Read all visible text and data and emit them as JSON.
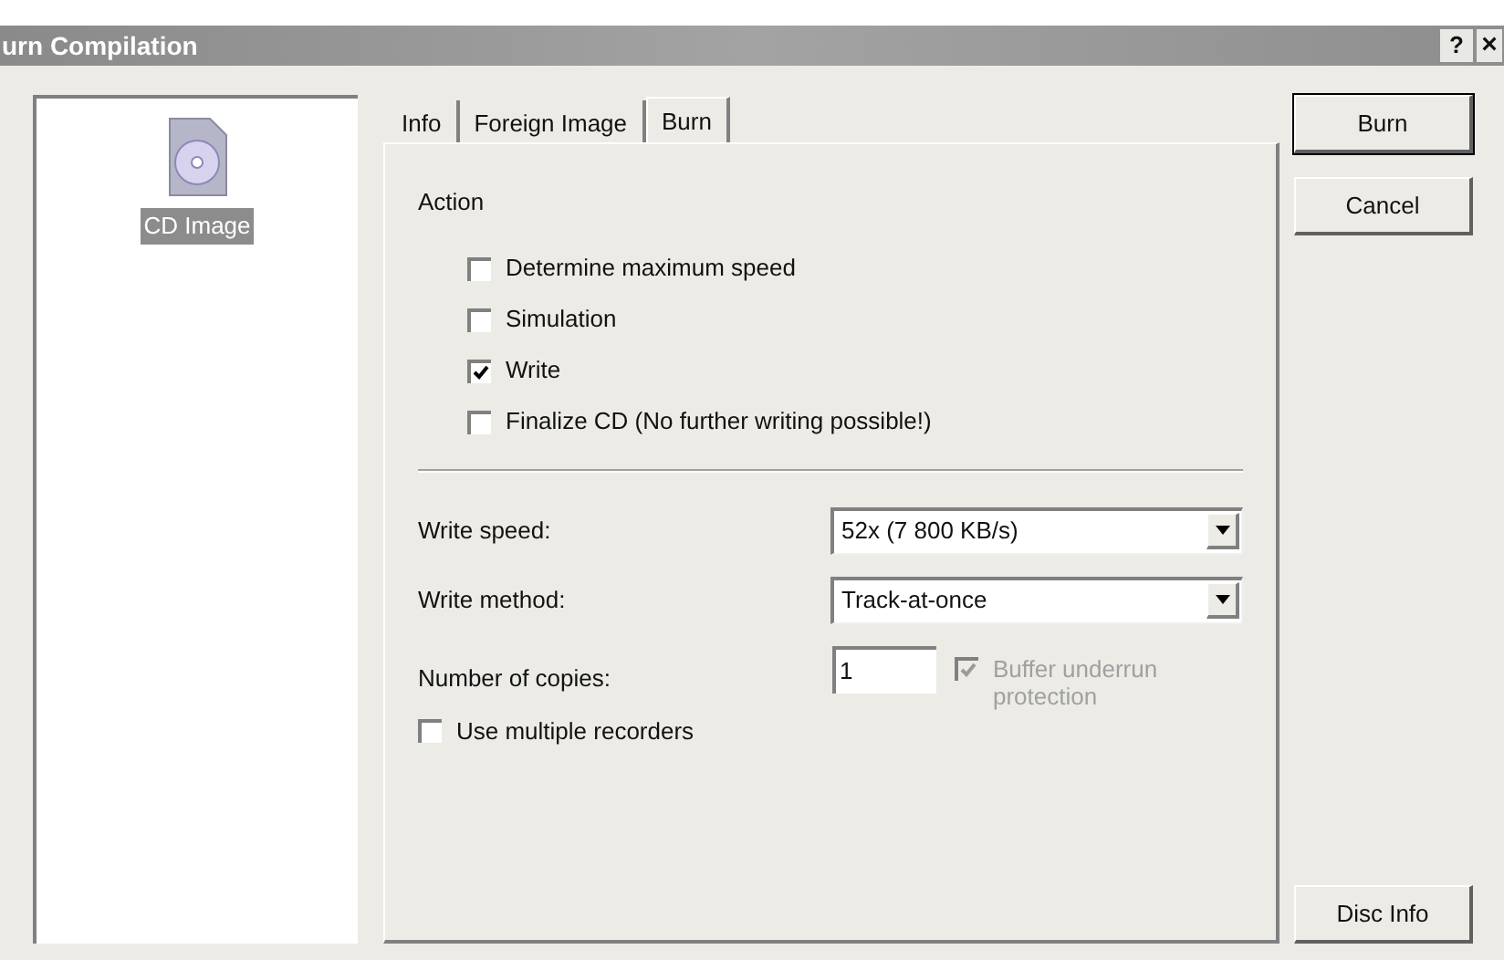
{
  "window": {
    "title": "urn Compilation",
    "help": "?",
    "close": "×"
  },
  "sidebar": {
    "items": [
      {
        "label": "CD Image",
        "selected": true
      }
    ]
  },
  "tabs": [
    {
      "label": "Info",
      "selected": false
    },
    {
      "label": "Foreign Image",
      "selected": false
    },
    {
      "label": "Burn",
      "selected": true
    }
  ],
  "action": {
    "heading": "Action",
    "options": [
      {
        "label": "Determine maximum speed",
        "checked": false
      },
      {
        "label": "Simulation",
        "checked": false
      },
      {
        "label": "Write",
        "checked": true
      },
      {
        "label": "Finalize CD (No further writing possible!)",
        "checked": false
      }
    ]
  },
  "settings": [
    {
      "label": "Write speed:",
      "value": "52x (7 800 KB/s)"
    },
    {
      "label": "Write method:",
      "value": "Track-at-once"
    }
  ],
  "copies": {
    "label": "Number of copies:",
    "value": "1"
  },
  "buffer_underrun": {
    "label": "Buffer underrun protection",
    "checked": true,
    "disabled": true
  },
  "multiple_recorders": {
    "label": "Use multiple recorders",
    "checked": false
  },
  "buttons": [
    {
      "label": "Burn",
      "default": true
    },
    {
      "label": "Cancel",
      "default": false
    }
  ],
  "disc_info_button": "Disc Info"
}
